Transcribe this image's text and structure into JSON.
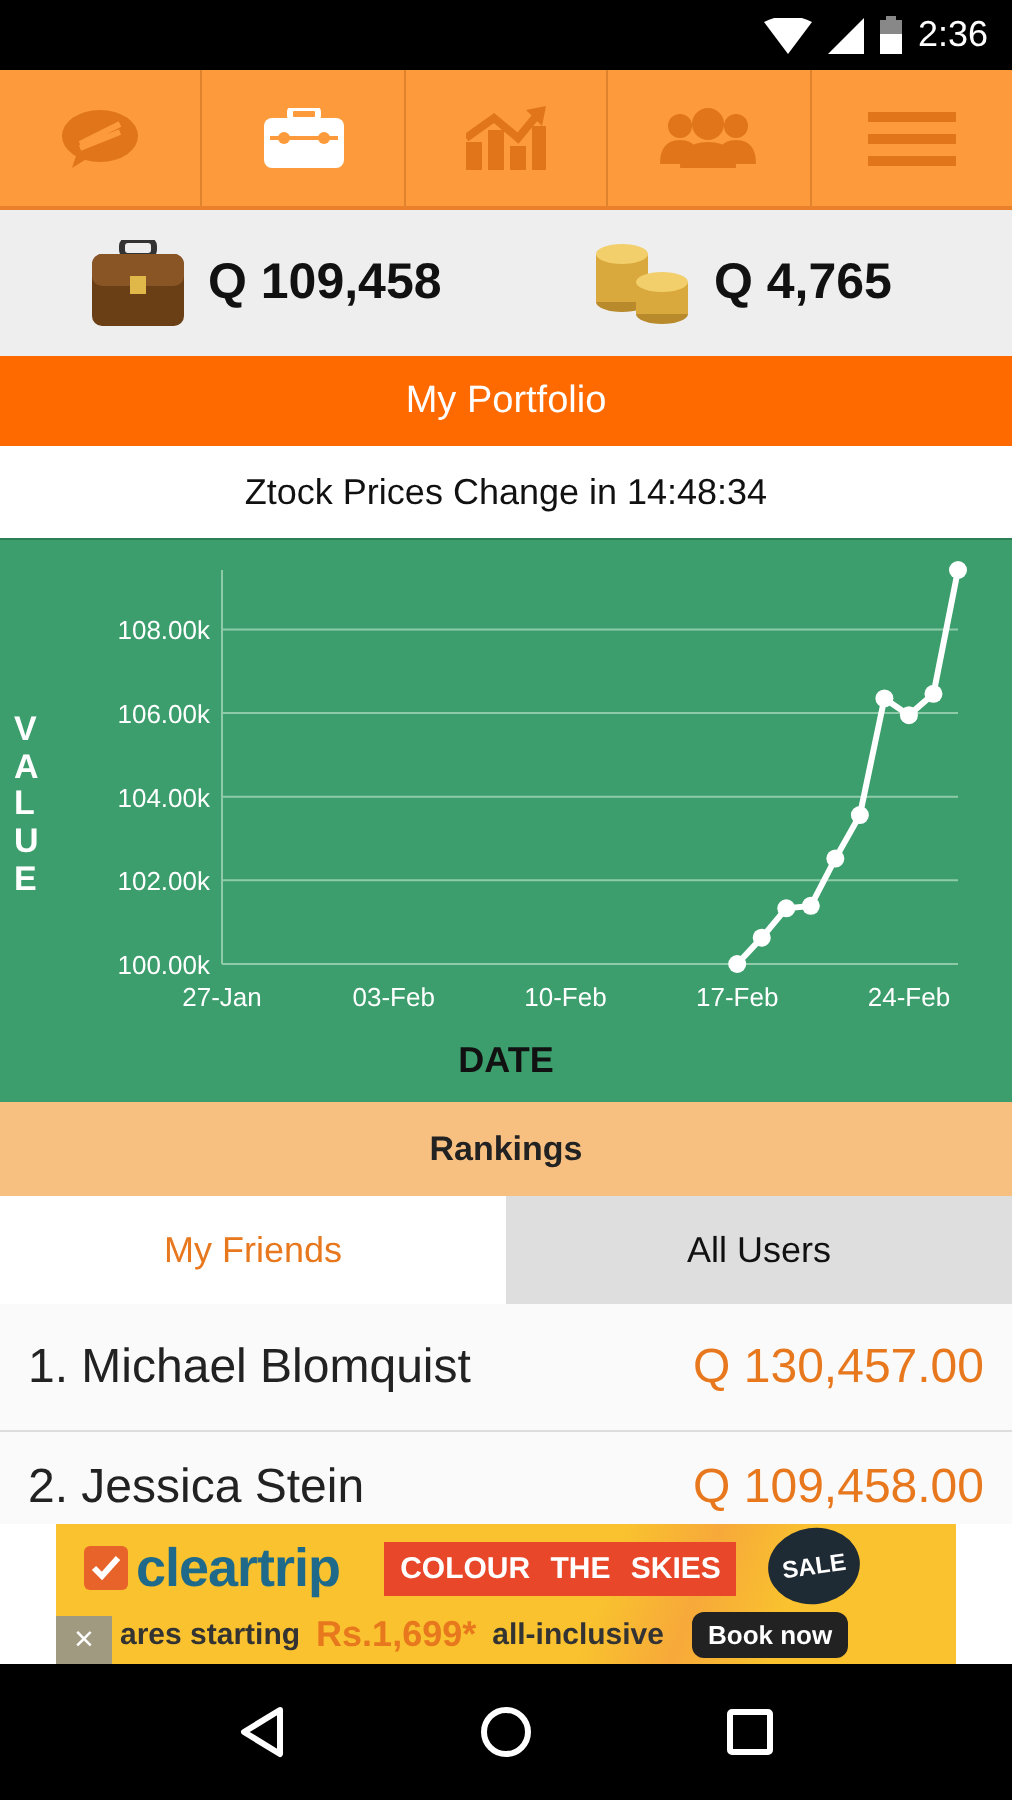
{
  "status_bar": {
    "time": "2:36"
  },
  "nav_tabs": [
    {
      "selected": false
    },
    {
      "selected": true
    },
    {
      "selected": false
    },
    {
      "selected": false
    },
    {
      "selected": false
    }
  ],
  "balances": [
    {
      "amount": "Q 109,458"
    },
    {
      "amount": "Q 4,765"
    }
  ],
  "section_title": "My Portfolio",
  "countdown": "Ztock Prices Change in 14:48:34",
  "chart": {
    "chart_data": {
      "type": "line",
      "xlabel": "DATE",
      "ylabel": "VALUE",
      "categories": [
        "27-Jan",
        null,
        null,
        null,
        null,
        null,
        null,
        "03-Feb",
        null,
        null,
        null,
        null,
        null,
        null,
        "10-Feb",
        null,
        null,
        null,
        null,
        null,
        null,
        "17-Feb",
        null,
        null,
        null,
        null,
        null,
        null,
        "24-Feb",
        null,
        null
      ],
      "grid": true,
      "ylim": [
        100000,
        109420
      ],
      "series": [
        {
          "color": "#ffffff",
          "marker": true,
          "values": [
            null,
            null,
            null,
            null,
            null,
            null,
            null,
            null,
            null,
            null,
            null,
            null,
            null,
            null,
            null,
            null,
            null,
            null,
            null,
            null,
            null,
            100000,
            100630,
            101330,
            101390,
            102520,
            103560,
            106350,
            105950,
            106460,
            109420
          ]
        }
      ],
      "yticks": [
        {
          "value": 100000,
          "label": "100.00k"
        },
        {
          "value": 102000,
          "label": "102.00k"
        },
        {
          "value": 104000,
          "label": "104.00k"
        },
        {
          "value": 106000,
          "label": "106.00k"
        },
        {
          "value": 108000,
          "label": "108.00k"
        }
      ]
    }
  },
  "rankings": {
    "title": "Rankings",
    "tabs": [
      {
        "label": "My Friends",
        "selected": true
      },
      {
        "label": "All Users",
        "selected": false
      }
    ],
    "rows": [
      {
        "name": "1. Michael Blomquist",
        "amount": "Q 130,457.00"
      },
      {
        "name": "2. Jessica Stein",
        "amount": "Q 109,458.00"
      }
    ]
  },
  "ad": {
    "brand": "cleartrip",
    "headline": "COLOUR THE SKIES",
    "badge": "SALE",
    "text": "ares starting",
    "price": "Rs.1,699*",
    "suffix": "all-inclusive",
    "button": "Book now",
    "close": "×"
  }
}
